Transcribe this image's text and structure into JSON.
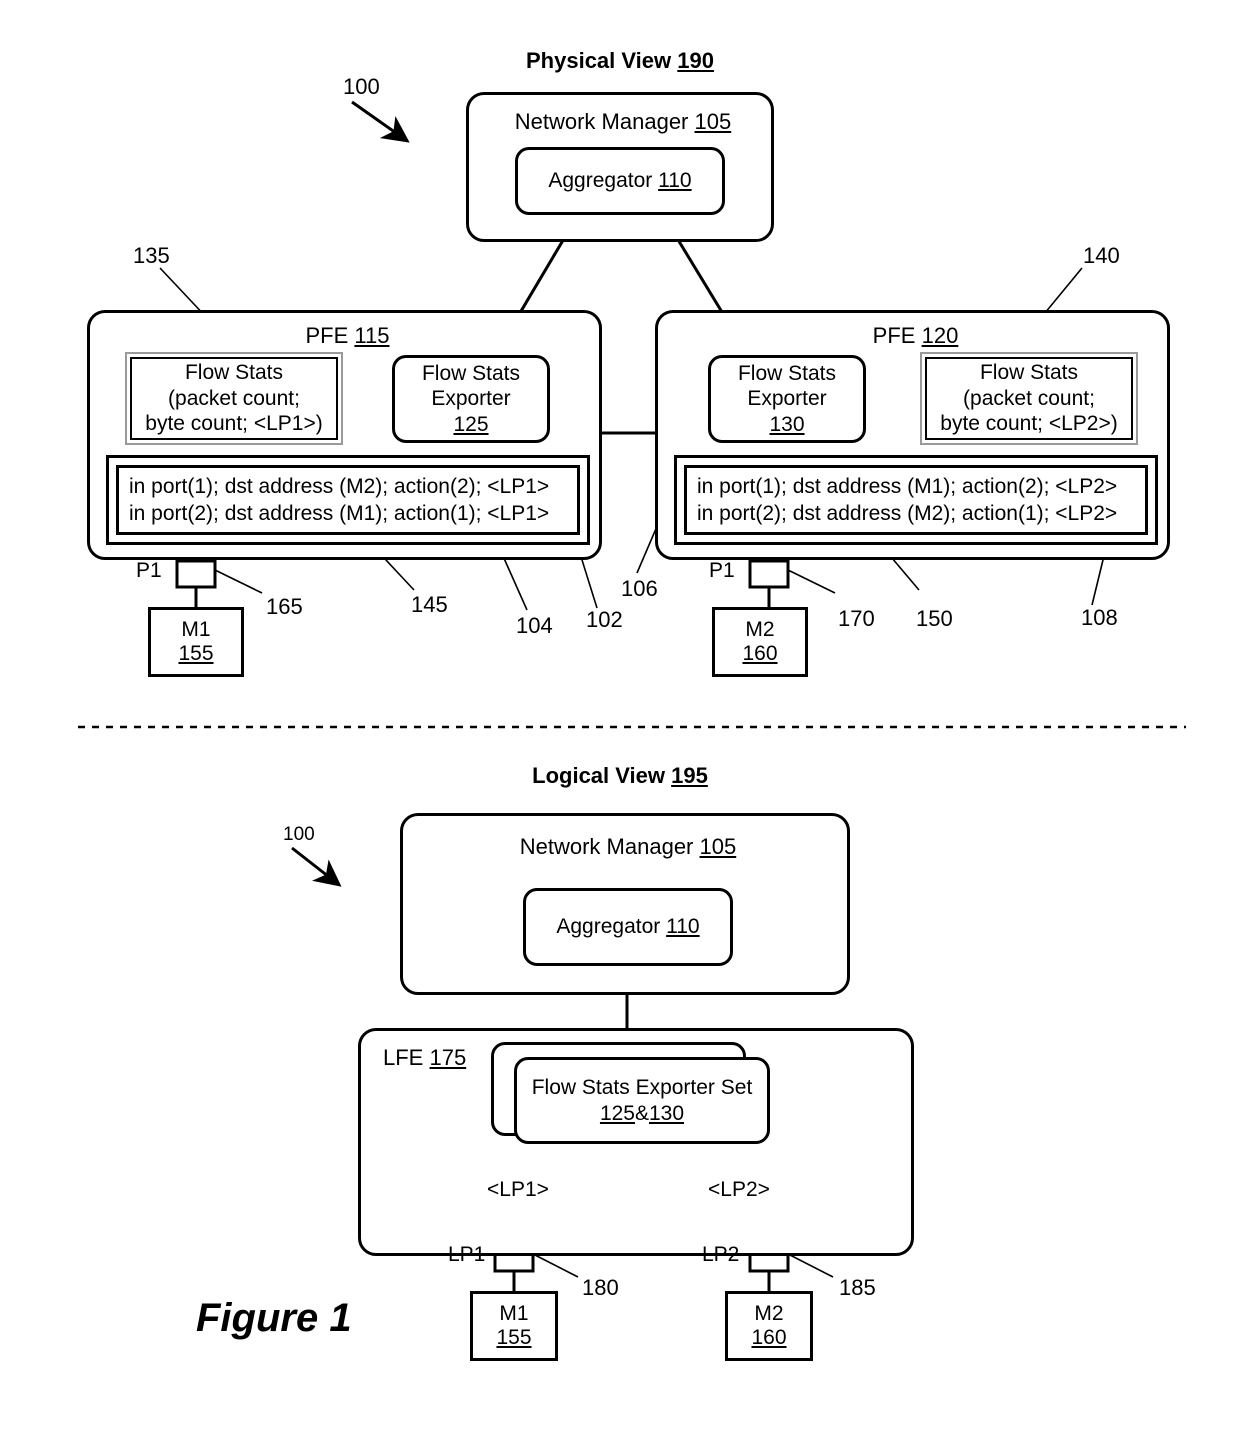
{
  "figure": {
    "caption": "Figure 1",
    "system_ref_top": "100",
    "system_ref_bottom": "100"
  },
  "physical_view": {
    "title": "Physical View",
    "title_ref": "190",
    "network_manager": {
      "label": "Network Manager",
      "ref": "105",
      "aggregator": {
        "label": "Aggregator",
        "ref": "110"
      }
    },
    "pfe_left": {
      "title": "PFE",
      "title_ref": "115",
      "callout_ref": "135",
      "flow_stats": {
        "line1": "Flow Stats",
        "line2": "(packet count;",
        "line3": "byte count; <LP1>)"
      },
      "exporter": {
        "line1": "Flow Stats",
        "line2": "Exporter",
        "ref": "125"
      },
      "rules": {
        "line1": "in port(1); dst address (M2); action(2); <LP1>",
        "line2": "in port(2); dst address (M1); action(1); <LP1>",
        "outer_ref": "145",
        "inner_ref": "104",
        "tag_ref": "102"
      },
      "port": {
        "label": "P1",
        "ref": "165"
      },
      "machine": {
        "name": "M1",
        "ref": "155"
      }
    },
    "pfe_right": {
      "title": "PFE",
      "title_ref": "120",
      "callout_ref": "140",
      "flow_stats": {
        "line1": "Flow Stats",
        "line2": "(packet count;",
        "line3": "byte count; <LP2>)"
      },
      "exporter": {
        "line1": "Flow Stats",
        "line2": "Exporter",
        "ref": "130"
      },
      "rules": {
        "line1": "in port(1); dst address (M1); action(2); <LP2>",
        "line2": "in port(2); dst address (M2); action(1); <LP2>",
        "outer_ref": "150",
        "inner_ref": "106",
        "tag_ref": "108"
      },
      "port": {
        "label": "P1",
        "ref": "170"
      },
      "machine": {
        "name": "M2",
        "ref": "160"
      }
    }
  },
  "logical_view": {
    "title": "Logical View",
    "title_ref": "195",
    "network_manager": {
      "label": "Network Manager",
      "ref": "105",
      "aggregator": {
        "label": "Aggregator",
        "ref": "110"
      }
    },
    "lfe": {
      "title": "LFE",
      "title_ref": "175",
      "exporter_set": {
        "line1": "Flow Stats Exporter Set",
        "ref_a": "125",
        "amp": "&",
        "ref_b": "130"
      },
      "link_left_label": "<LP1>",
      "link_right_label": "<LP2>"
    },
    "logical_port_left": {
      "label": "LP1",
      "ref": "180",
      "machine": {
        "name": "M1",
        "ref": "155"
      }
    },
    "logical_port_right": {
      "label": "LP2",
      "ref": "185",
      "machine": {
        "name": "M2",
        "ref": "160"
      }
    }
  }
}
